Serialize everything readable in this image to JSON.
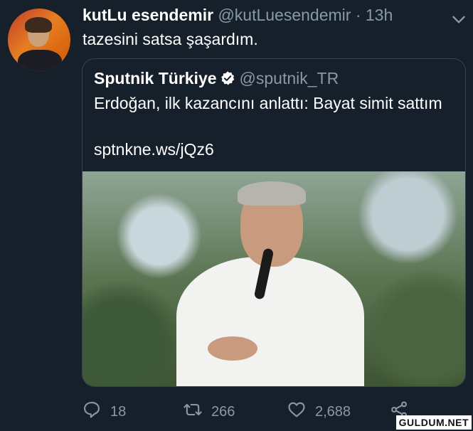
{
  "tweet": {
    "display_name": "kutLu esendemir",
    "handle": "@kutLuesendemir",
    "separator": "·",
    "time": "13h",
    "text": "tazesini satsa şaşardım."
  },
  "quoted_tweet": {
    "display_name": "Sputnik Türkiye",
    "handle": "@sputnik_TR",
    "verified": true,
    "text": "Erdoğan, ilk kazancını anlattı: Bayat simit sattım",
    "link": "sptnkne.ws/jQz6"
  },
  "actions": {
    "replies": "18",
    "retweets": "266",
    "likes": "2,688"
  },
  "watermark": "GULDUM.NET",
  "colors": {
    "background": "#15202b",
    "secondary_text": "#8899a6",
    "border": "#38444d",
    "verified_badge": "#ffffff"
  },
  "icons": [
    "chevron-down-icon",
    "verified-badge-icon",
    "reply-icon",
    "retweet-icon",
    "like-icon",
    "share-icon"
  ]
}
